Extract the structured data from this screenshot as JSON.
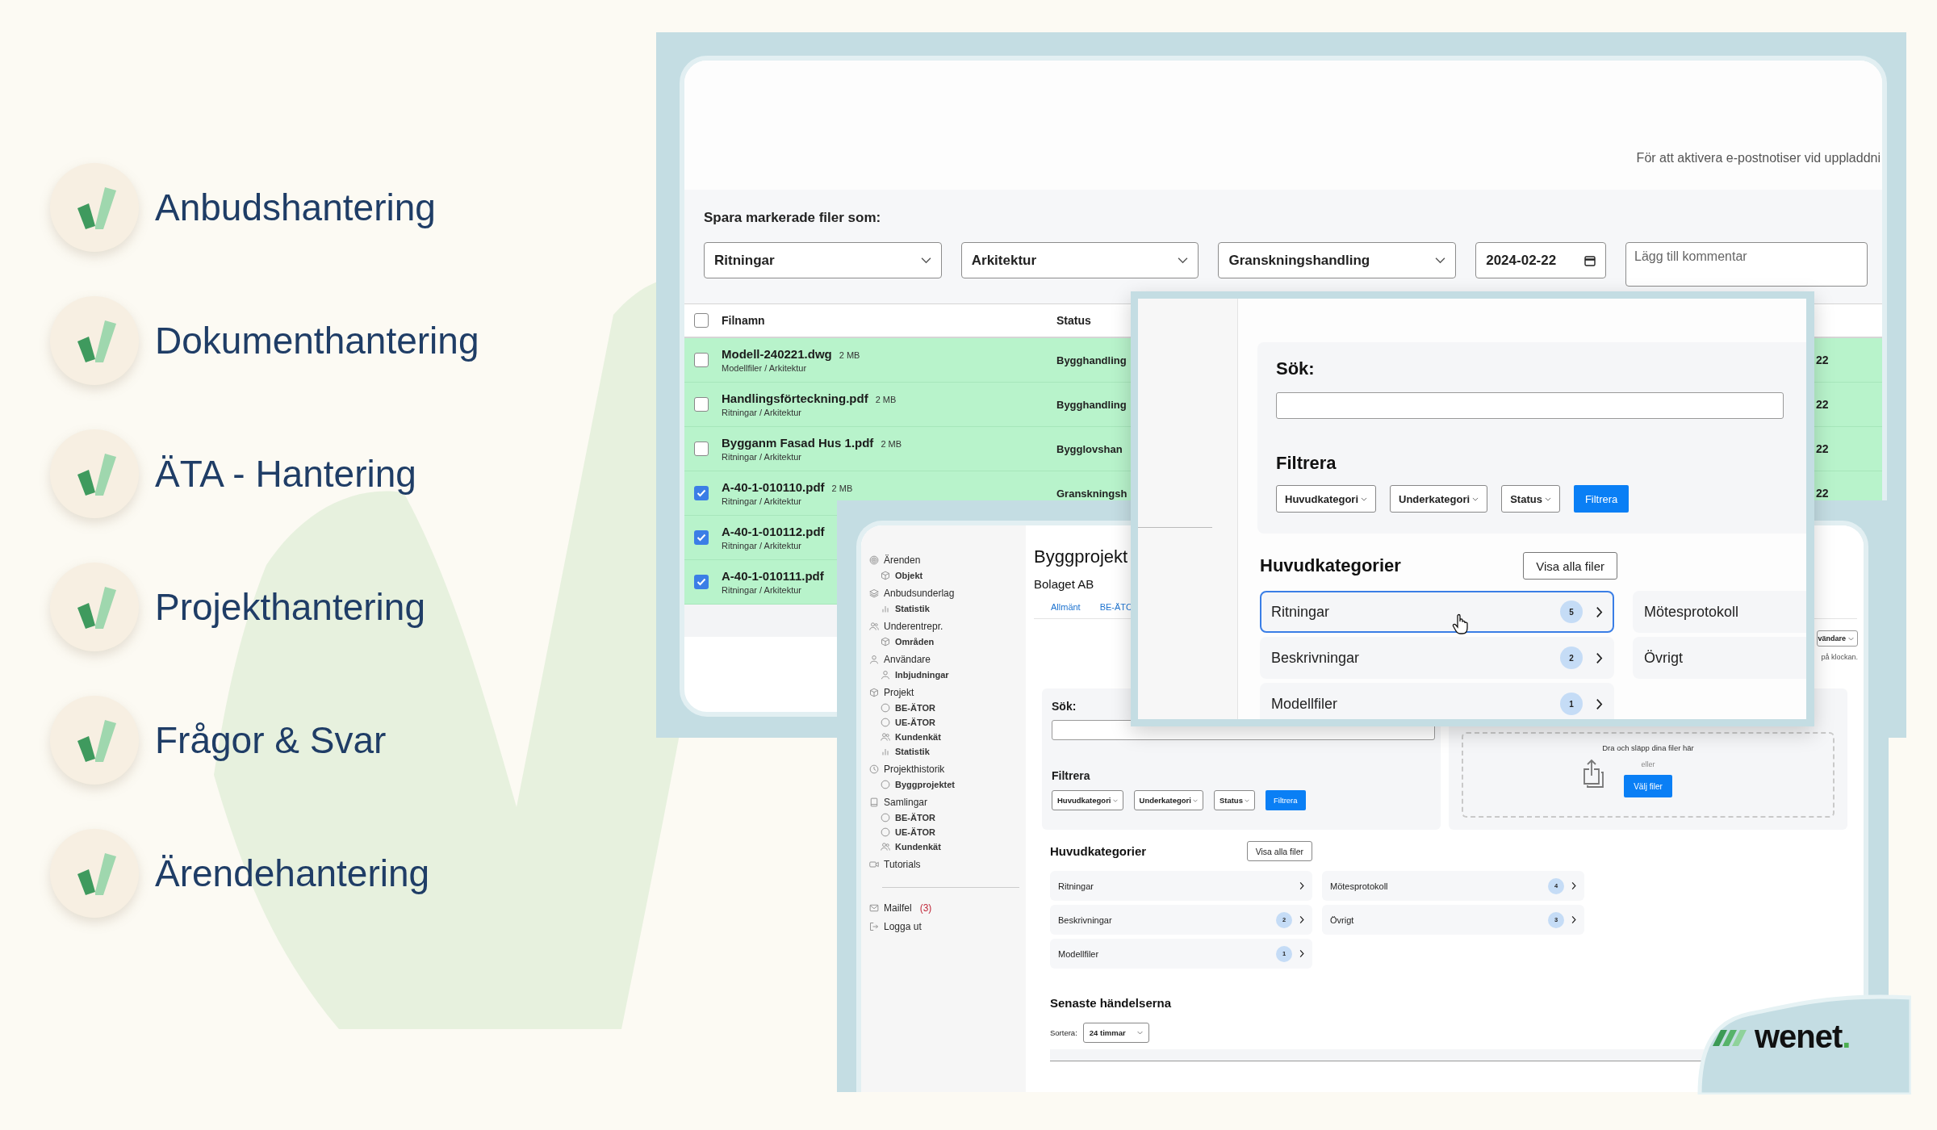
{
  "features": [
    {
      "label": "Anbudshantering"
    },
    {
      "label": "Dokumenthantering"
    },
    {
      "label": "ÄTA - Hantering"
    },
    {
      "label": "Projekthantering"
    },
    {
      "label": "Frågor & Svar"
    },
    {
      "label": "Ärendehantering"
    }
  ],
  "back_window": {
    "notice": "För att aktivera e-postnotiser vid uppladdni",
    "save_label": "Spara markerade filer som:",
    "selects": [
      "Ritningar",
      "Arkitektur",
      "Granskningshandling"
    ],
    "date": "2024-02-22",
    "comment": {
      "placeholder": "Lägg till kommentar"
    },
    "table": {
      "columns": [
        "Filnamn",
        "Status"
      ],
      "select_all_checked": false,
      "rows": [
        {
          "name": "Modell-240221.dwg",
          "size": "2 MB",
          "path": "Modellfiler / Arkitektur",
          "status": "Bygghandling",
          "date": "22",
          "checked": false
        },
        {
          "name": "Handlingsförteckning.pdf",
          "size": "2 MB",
          "path": "Ritningar / Arkitektur",
          "status": "Bygghandling",
          "date": "22",
          "checked": false
        },
        {
          "name": "Bygganm Fasad Hus 1.pdf",
          "size": "2 MB",
          "path": "Ritningar / Arkitektur",
          "status": "Bygglovshan",
          "date": "22",
          "checked": false
        },
        {
          "name": "A-40-1-010110.pdf",
          "size": "2 MB",
          "path": "Ritningar / Arkitektur",
          "status": "Granskningsh",
          "date": "22",
          "checked": true
        },
        {
          "name": "A-40-1-010112.pdf",
          "path": "Ritningar / Arkitektur",
          "checked": true
        },
        {
          "name": "A-40-1-010111.pdf",
          "path": "Ritningar / Arkitektur",
          "checked": true
        }
      ]
    }
  },
  "popup": {
    "search_label": "Sök:",
    "filter_label": "Filtrera",
    "filter_selects": [
      "Huvudkategori",
      "Underkategori",
      "Status"
    ],
    "filter_button": "Filtrera",
    "categories_heading": "Huvudkategorier",
    "show_all_button": "Visa alla filer",
    "categories": [
      {
        "name": "Ritningar",
        "count": "5",
        "selected": true
      },
      {
        "name": "Mötesprotokoll",
        "selected": false
      },
      {
        "name": "Beskrivningar",
        "count": "2",
        "selected": false
      },
      {
        "name": "Övrigt",
        "selected": false
      },
      {
        "name": "Modellfiler",
        "count": "1",
        "selected": false
      }
    ]
  },
  "front_window": {
    "sidebar": [
      {
        "label": "Ärenden",
        "children": [
          {
            "label": "Objekt"
          }
        ]
      },
      {
        "label": "Anbudsunderlag",
        "children": [
          {
            "label": "Statistik"
          }
        ]
      },
      {
        "label": "Underentrepr.",
        "children": [
          {
            "label": "Områden"
          }
        ]
      },
      {
        "label": "Användare",
        "children": [
          {
            "label": "Inbjudningar"
          }
        ]
      },
      {
        "label": "Projekt",
        "children": [
          {
            "label": "BE-ÄTOR"
          },
          {
            "label": "UE-ÄTOR"
          },
          {
            "label": "Kundenkät"
          },
          {
            "label": "Statistik"
          }
        ]
      },
      {
        "label": "Projekthistorik",
        "children": [
          {
            "label": "Byggprojektet"
          }
        ]
      },
      {
        "label": "Samlingar",
        "children": [
          {
            "label": "BE-ÄTOR"
          },
          {
            "label": "UE-ÄTOR"
          },
          {
            "label": "Kundenkät"
          }
        ]
      },
      {
        "label": "Tutorials"
      }
    ],
    "footer_items": [
      {
        "label": "Mailfel",
        "count": "(3)"
      },
      {
        "label": "Logga ut"
      }
    ],
    "title": "Byggprojekt",
    "company": "Bolaget AB",
    "tabs": [
      {
        "label": "Allmänt"
      },
      {
        "label": "BE-ÄTO"
      }
    ],
    "user_select": "vändare",
    "hint": "på klockan.",
    "search_label": "Sök:",
    "filter_label": "Filtrera",
    "filter_selects": [
      "Huvudkategori",
      "Underkategori",
      "Status"
    ],
    "filter_button": "Filtrera",
    "upload": {
      "prompt": "Dra och släpp dina filer här",
      "or": "eller",
      "button": "Välj filer"
    },
    "categories_heading": "Huvudkategorier",
    "show_all_button": "Visa alla filer",
    "categories": [
      {
        "name": "Ritningar",
        "selected": false
      },
      {
        "name": "Mötesprotokoll",
        "count": "4",
        "selected": false
      },
      {
        "name": "Beskrivningar",
        "count": "2",
        "selected": false
      },
      {
        "name": "Övrigt",
        "count": "3",
        "selected": false
      },
      {
        "name": "Modellfiler",
        "count": "1",
        "selected": false
      }
    ],
    "events_heading": "Senaste händelserna",
    "sort_label": "Sortera:",
    "sort_value": "24 timmar"
  },
  "logo": {
    "text": "wenet",
    "dot": "."
  }
}
